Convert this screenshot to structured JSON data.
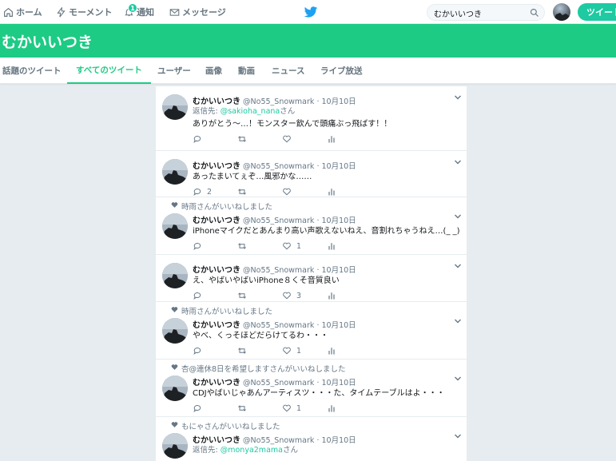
{
  "nav": {
    "home": "ホーム",
    "moments": "モーメント",
    "notifications": "通知",
    "notifications_badge": "1",
    "messages": "メッセージ",
    "search_value": "むかいいつき",
    "tweet_button": "ツイート"
  },
  "banner": {
    "title": "むかいいつき"
  },
  "tabs": [
    "話題のツイート",
    "すべてのツイート",
    "ユーザー",
    "画像",
    "動画",
    "ニュース",
    "ライブ放送"
  ],
  "tweets": [
    {
      "context": "",
      "name": "むかいいつき",
      "handle": "@No55_Snowmark",
      "date": "· 10月10日",
      "reply_prefix": "返信先: ",
      "reply_handle": "@sakioha_nana",
      "reply_suffix": "さん",
      "text": "ありがとう～…！モンスター飲んで頭痛ぶっ飛ばす！！",
      "replies": "",
      "retweets": "",
      "likes": ""
    },
    {
      "context": "",
      "name": "むかいいつき",
      "handle": "@No55_Snowmark",
      "date": "· 10月10日",
      "reply_prefix": "",
      "reply_handle": "",
      "reply_suffix": "",
      "text": "あったまいてぇぞ…風邪かな……",
      "replies": "2",
      "retweets": "",
      "likes": ""
    },
    {
      "context": "時雨さんがいいねしました",
      "name": "むかいいつき",
      "handle": "@No55_Snowmark",
      "date": "· 10月10日",
      "reply_prefix": "",
      "reply_handle": "",
      "reply_suffix": "",
      "text": "iPhoneマイクだとあんまり高い声歌えないねえ、音割れちゃうねえ…(_ _)",
      "replies": "",
      "retweets": "",
      "likes": "1"
    },
    {
      "context": "",
      "name": "むかいいつき",
      "handle": "@No55_Snowmark",
      "date": "· 10月10日",
      "reply_prefix": "",
      "reply_handle": "",
      "reply_suffix": "",
      "text": "え、やばいやばいiPhone８くそ音質良い",
      "replies": "",
      "retweets": "",
      "likes": "3"
    },
    {
      "context": "時雨さんがいいねしました",
      "name": "むかいいつき",
      "handle": "@No55_Snowmark",
      "date": "· 10月10日",
      "reply_prefix": "",
      "reply_handle": "",
      "reply_suffix": "",
      "text": "やべ、くっそほどだらけてるわ・・・",
      "replies": "",
      "retweets": "",
      "likes": "1"
    },
    {
      "context": "杏@連休8日を希望しますさんがいいねしました",
      "name": "むかいいつき",
      "handle": "@No55_Snowmark",
      "date": "· 10月10日",
      "reply_prefix": "",
      "reply_handle": "",
      "reply_suffix": "",
      "text": "CDJやばいじゃあんアーティスツ・・・た、タイムテーブルはよ・・・",
      "replies": "",
      "retweets": "",
      "likes": "1"
    },
    {
      "context": "もにゃさんがいいねしました",
      "name": "むかいいつき",
      "handle": "@No55_Snowmark",
      "date": "· 10月10日",
      "reply_prefix": "返信先: ",
      "reply_handle": "@monya2mama",
      "reply_suffix": "さん",
      "text": "",
      "replies": "",
      "retweets": "",
      "likes": ""
    }
  ],
  "colors": {
    "accent": "#1dcb84",
    "link": "#1dcaa2",
    "muted": "#657786",
    "bg": "#e6ecf0"
  }
}
